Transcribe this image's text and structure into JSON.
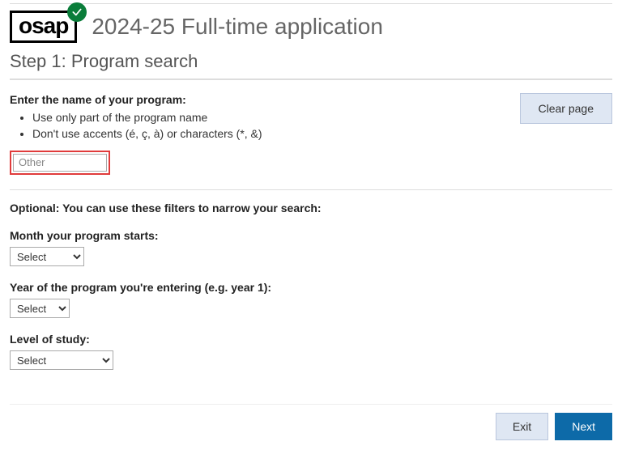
{
  "logo": {
    "text": "osap"
  },
  "header": {
    "page_title": "2024-25 Full-time application",
    "step_title": "Step 1: Program search"
  },
  "program": {
    "label": "Enter the name of your program:",
    "hints": [
      "Use only part of the program name",
      "Don't use accents (é, ç, à) or characters (*, &)"
    ],
    "input_value": "Other"
  },
  "buttons": {
    "clear": "Clear page",
    "exit": "Exit",
    "next": "Next"
  },
  "filters": {
    "heading": "Optional: You can use these filters to narrow your search:",
    "month": {
      "label": "Month your program starts:",
      "selected": "Select"
    },
    "year": {
      "label": "Year of the program you're entering (e.g. year 1):",
      "selected": "Select"
    },
    "level": {
      "label": "Level of study:",
      "selected": "Select"
    }
  }
}
